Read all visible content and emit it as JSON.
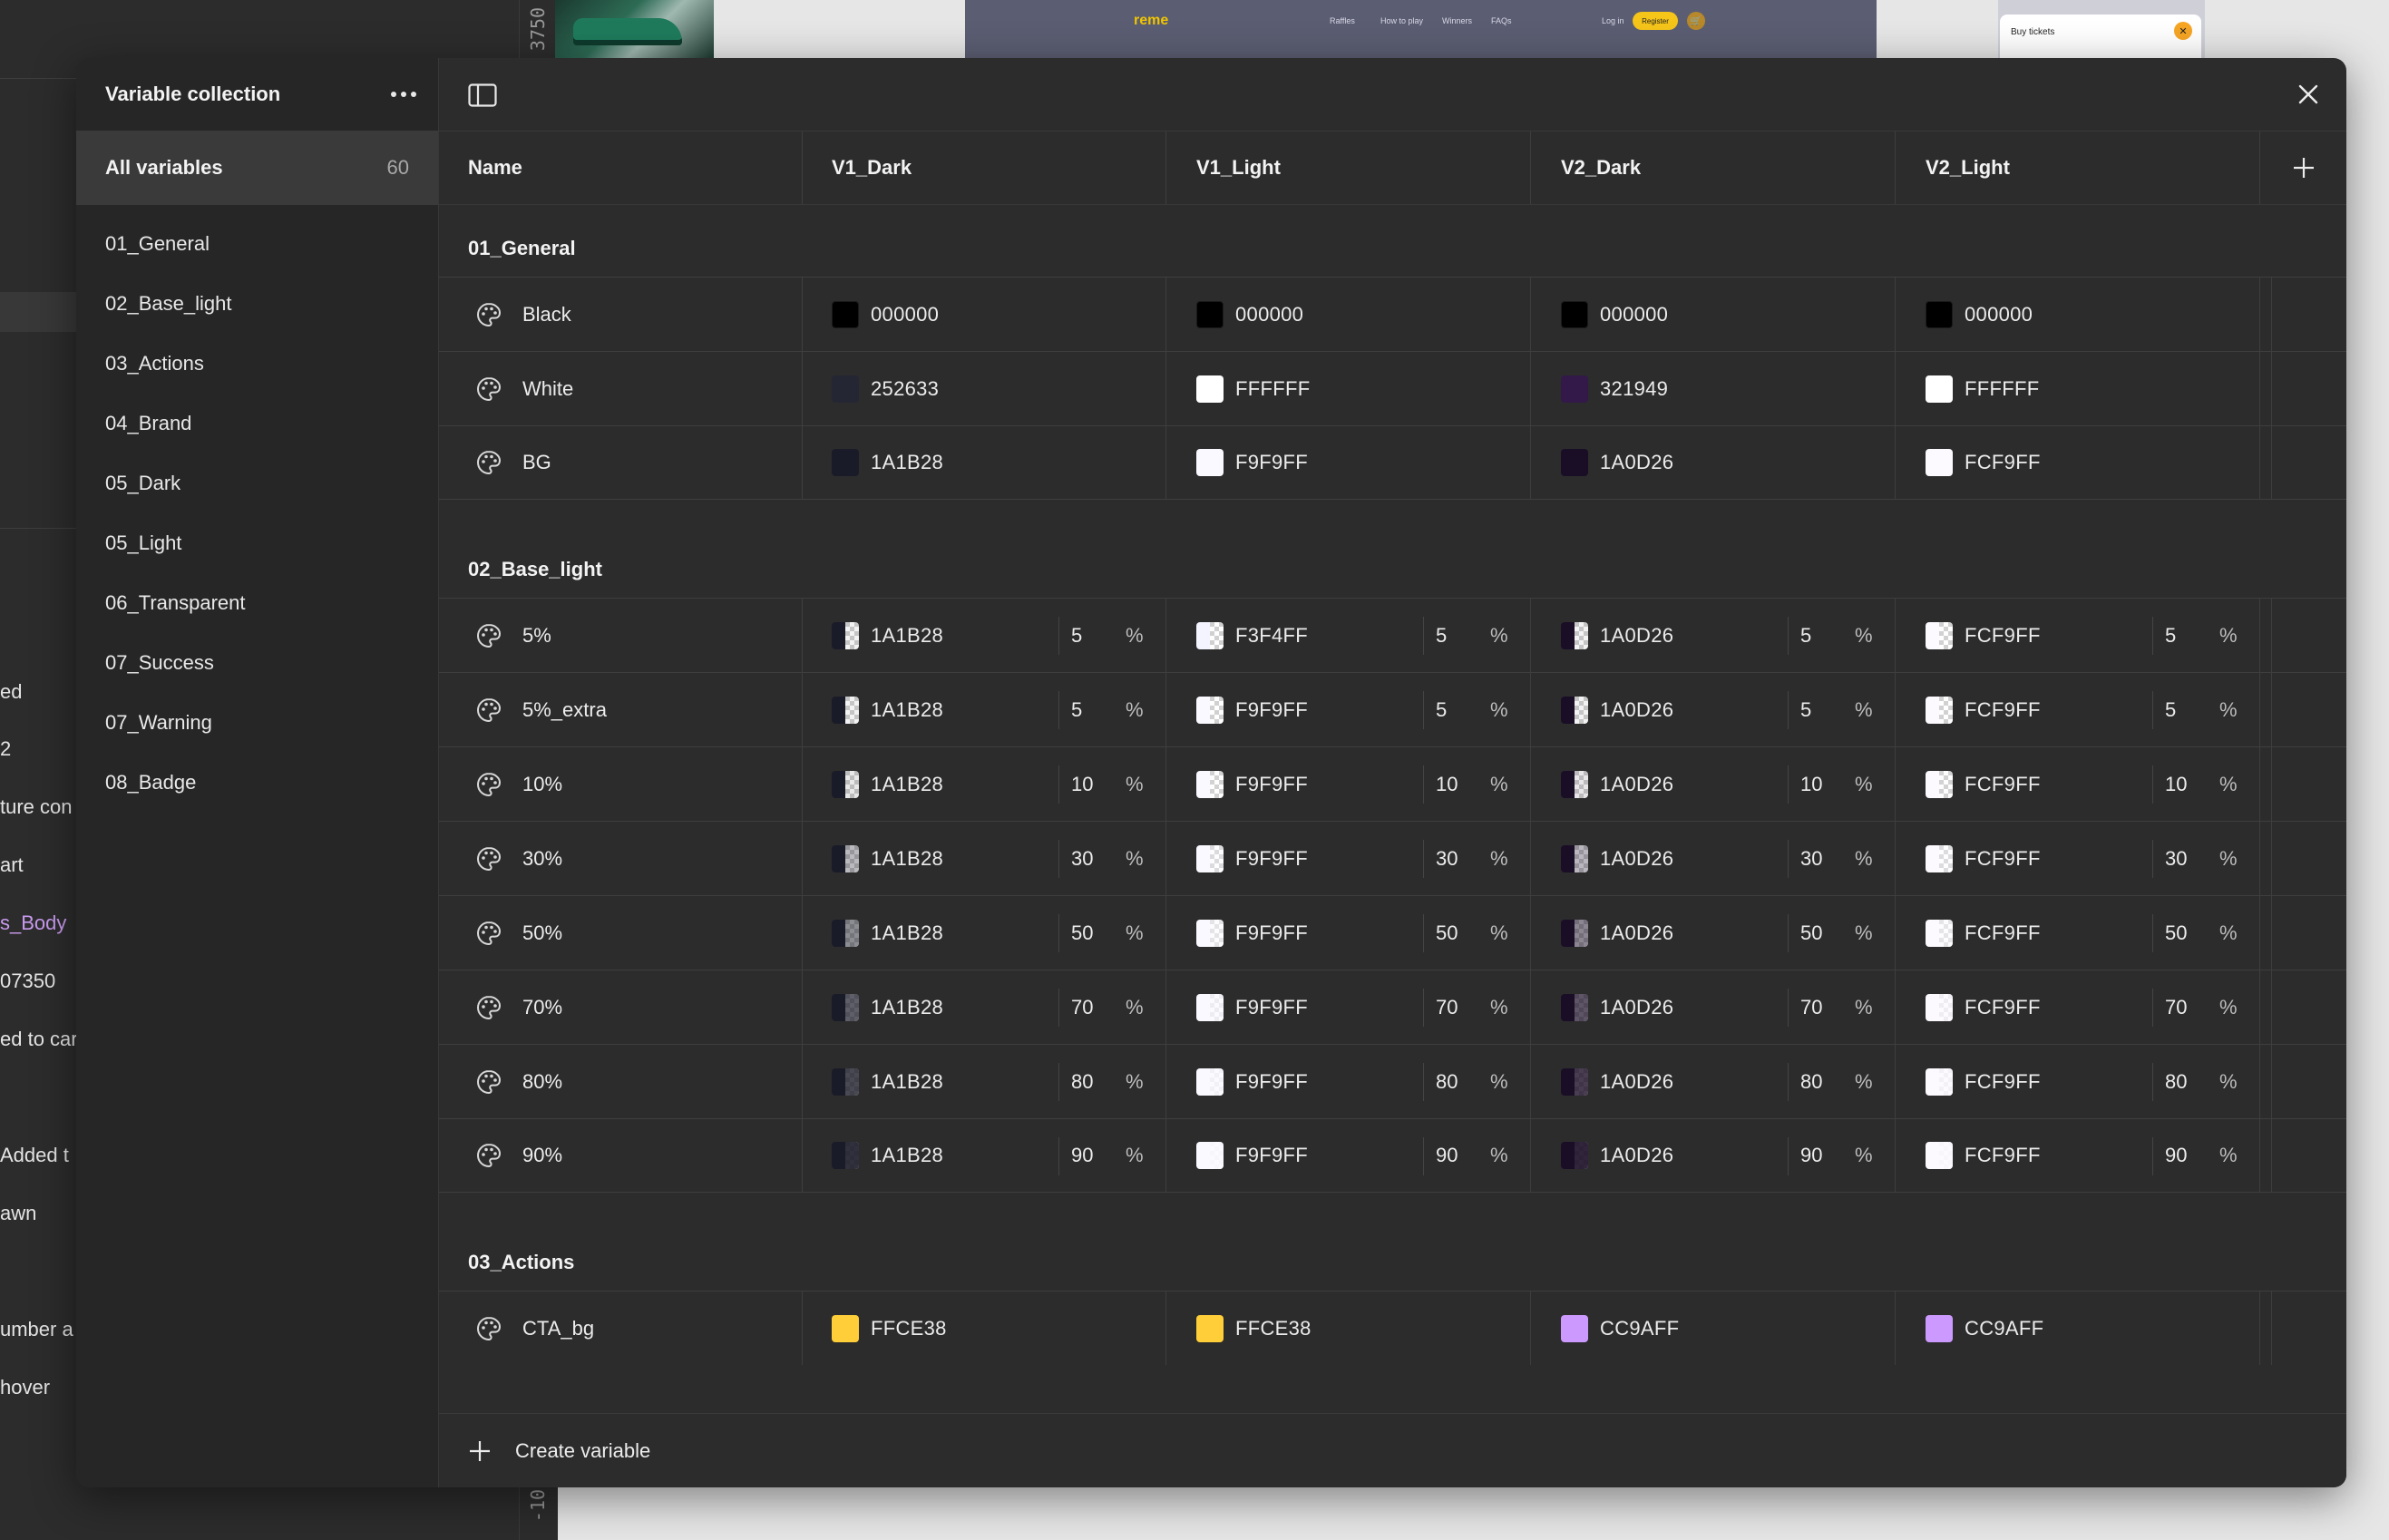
{
  "background": {
    "left_texts": [
      "ed",
      "2",
      "ture con",
      "art",
      "s_Body",
      "07350",
      "ed to car",
      "Added t",
      "awn",
      "umber a",
      "hover"
    ],
    "ruler_top": "3750",
    "ruler_bottom": "-10",
    "site": {
      "logo": "reme",
      "nav": [
        "Raffles",
        "How to play",
        "Winners",
        "FAQs",
        "Log in"
      ],
      "register": "Register",
      "cart_icon": "🛒"
    },
    "mini_card": "Buy tickets"
  },
  "sidebar": {
    "title": "Variable collection",
    "all_label": "All variables",
    "all_count": "60",
    "items": [
      "01_General",
      "02_Base_light",
      "03_Actions",
      "04_Brand",
      "05_Dark",
      "05_Light",
      "06_Transparent",
      "07_Success",
      "07_Warning",
      "08_Badge"
    ]
  },
  "table": {
    "columns": [
      "Name",
      "V1_Dark",
      "V1_Light",
      "V2_Dark",
      "V2_Light"
    ],
    "groups": [
      {
        "name": "01_General",
        "rows": [
          {
            "name": "Black",
            "values": [
              {
                "hex": "000000",
                "color": "#000000"
              },
              {
                "hex": "000000",
                "color": "#000000"
              },
              {
                "hex": "000000",
                "color": "#000000"
              },
              {
                "hex": "000000",
                "color": "#000000"
              }
            ]
          },
          {
            "name": "White",
            "values": [
              {
                "hex": "252633",
                "color": "#252633"
              },
              {
                "hex": "FFFFFF",
                "color": "#FFFFFF"
              },
              {
                "hex": "321949",
                "color": "#321949"
              },
              {
                "hex": "FFFFFF",
                "color": "#FFFFFF"
              }
            ]
          },
          {
            "name": "BG",
            "values": [
              {
                "hex": "1A1B28",
                "color": "#1A1B28"
              },
              {
                "hex": "F9F9FF",
                "color": "#F9F9FF"
              },
              {
                "hex": "1A0D26",
                "color": "#1A0D26"
              },
              {
                "hex": "FCF9FF",
                "color": "#FCF9FF"
              }
            ]
          }
        ]
      },
      {
        "name": "02_Base_light",
        "rows": [
          {
            "name": "5%",
            "values": [
              {
                "hex": "1A1B28",
                "color": "#1A1B28",
                "opacity": "5"
              },
              {
                "hex": "F3F4FF",
                "color": "#F3F4FF",
                "opacity": "5"
              },
              {
                "hex": "1A0D26",
                "color": "#1A0D26",
                "opacity": "5"
              },
              {
                "hex": "FCF9FF",
                "color": "#FCF9FF",
                "opacity": "5"
              }
            ]
          },
          {
            "name": "5%_extra",
            "values": [
              {
                "hex": "1A1B28",
                "color": "#1A1B28",
                "opacity": "5"
              },
              {
                "hex": "F9F9FF",
                "color": "#F9F9FF",
                "opacity": "5"
              },
              {
                "hex": "1A0D26",
                "color": "#1A0D26",
                "opacity": "5"
              },
              {
                "hex": "FCF9FF",
                "color": "#FCF9FF",
                "opacity": "5"
              }
            ]
          },
          {
            "name": "10%",
            "values": [
              {
                "hex": "1A1B28",
                "color": "#1A1B28",
                "opacity": "10"
              },
              {
                "hex": "F9F9FF",
                "color": "#F9F9FF",
                "opacity": "10"
              },
              {
                "hex": "1A0D26",
                "color": "#1A0D26",
                "opacity": "10"
              },
              {
                "hex": "FCF9FF",
                "color": "#FCF9FF",
                "opacity": "10"
              }
            ]
          },
          {
            "name": "30%",
            "values": [
              {
                "hex": "1A1B28",
                "color": "#1A1B28",
                "opacity": "30"
              },
              {
                "hex": "F9F9FF",
                "color": "#F9F9FF",
                "opacity": "30"
              },
              {
                "hex": "1A0D26",
                "color": "#1A0D26",
                "opacity": "30"
              },
              {
                "hex": "FCF9FF",
                "color": "#FCF9FF",
                "opacity": "30"
              }
            ]
          },
          {
            "name": "50%",
            "values": [
              {
                "hex": "1A1B28",
                "color": "#1A1B28",
                "opacity": "50"
              },
              {
                "hex": "F9F9FF",
                "color": "#F9F9FF",
                "opacity": "50"
              },
              {
                "hex": "1A0D26",
                "color": "#1A0D26",
                "opacity": "50"
              },
              {
                "hex": "FCF9FF",
                "color": "#FCF9FF",
                "opacity": "50"
              }
            ]
          },
          {
            "name": "70%",
            "values": [
              {
                "hex": "1A1B28",
                "color": "#1A1B28",
                "opacity": "70"
              },
              {
                "hex": "F9F9FF",
                "color": "#F9F9FF",
                "opacity": "70"
              },
              {
                "hex": "1A0D26",
                "color": "#1A0D26",
                "opacity": "70"
              },
              {
                "hex": "FCF9FF",
                "color": "#FCF9FF",
                "opacity": "70"
              }
            ]
          },
          {
            "name": "80%",
            "values": [
              {
                "hex": "1A1B28",
                "color": "#1A1B28",
                "opacity": "80"
              },
              {
                "hex": "F9F9FF",
                "color": "#F9F9FF",
                "opacity": "80"
              },
              {
                "hex": "1A0D26",
                "color": "#1A0D26",
                "opacity": "80"
              },
              {
                "hex": "FCF9FF",
                "color": "#FCF9FF",
                "opacity": "80"
              }
            ]
          },
          {
            "name": "90%",
            "values": [
              {
                "hex": "1A1B28",
                "color": "#1A1B28",
                "opacity": "90"
              },
              {
                "hex": "F9F9FF",
                "color": "#F9F9FF",
                "opacity": "90"
              },
              {
                "hex": "1A0D26",
                "color": "#1A0D26",
                "opacity": "90"
              },
              {
                "hex": "FCF9FF",
                "color": "#FCF9FF",
                "opacity": "90"
              }
            ]
          }
        ]
      },
      {
        "name": "03_Actions",
        "rows": [
          {
            "name": "CTA_bg",
            "values": [
              {
                "hex": "FFCE38",
                "color": "#FFCE38"
              },
              {
                "hex": "FFCE38",
                "color": "#FFCE38"
              },
              {
                "hex": "CC9AFF",
                "color": "#CC9AFF"
              },
              {
                "hex": "CC9AFF",
                "color": "#CC9AFF"
              }
            ]
          }
        ]
      }
    ]
  },
  "footer": {
    "create_label": "Create variable"
  },
  "icons": {
    "row_icon": "palette-icon",
    "toggle": "sidebar-toggle-icon",
    "close": "close-icon",
    "add": "plus-icon"
  }
}
